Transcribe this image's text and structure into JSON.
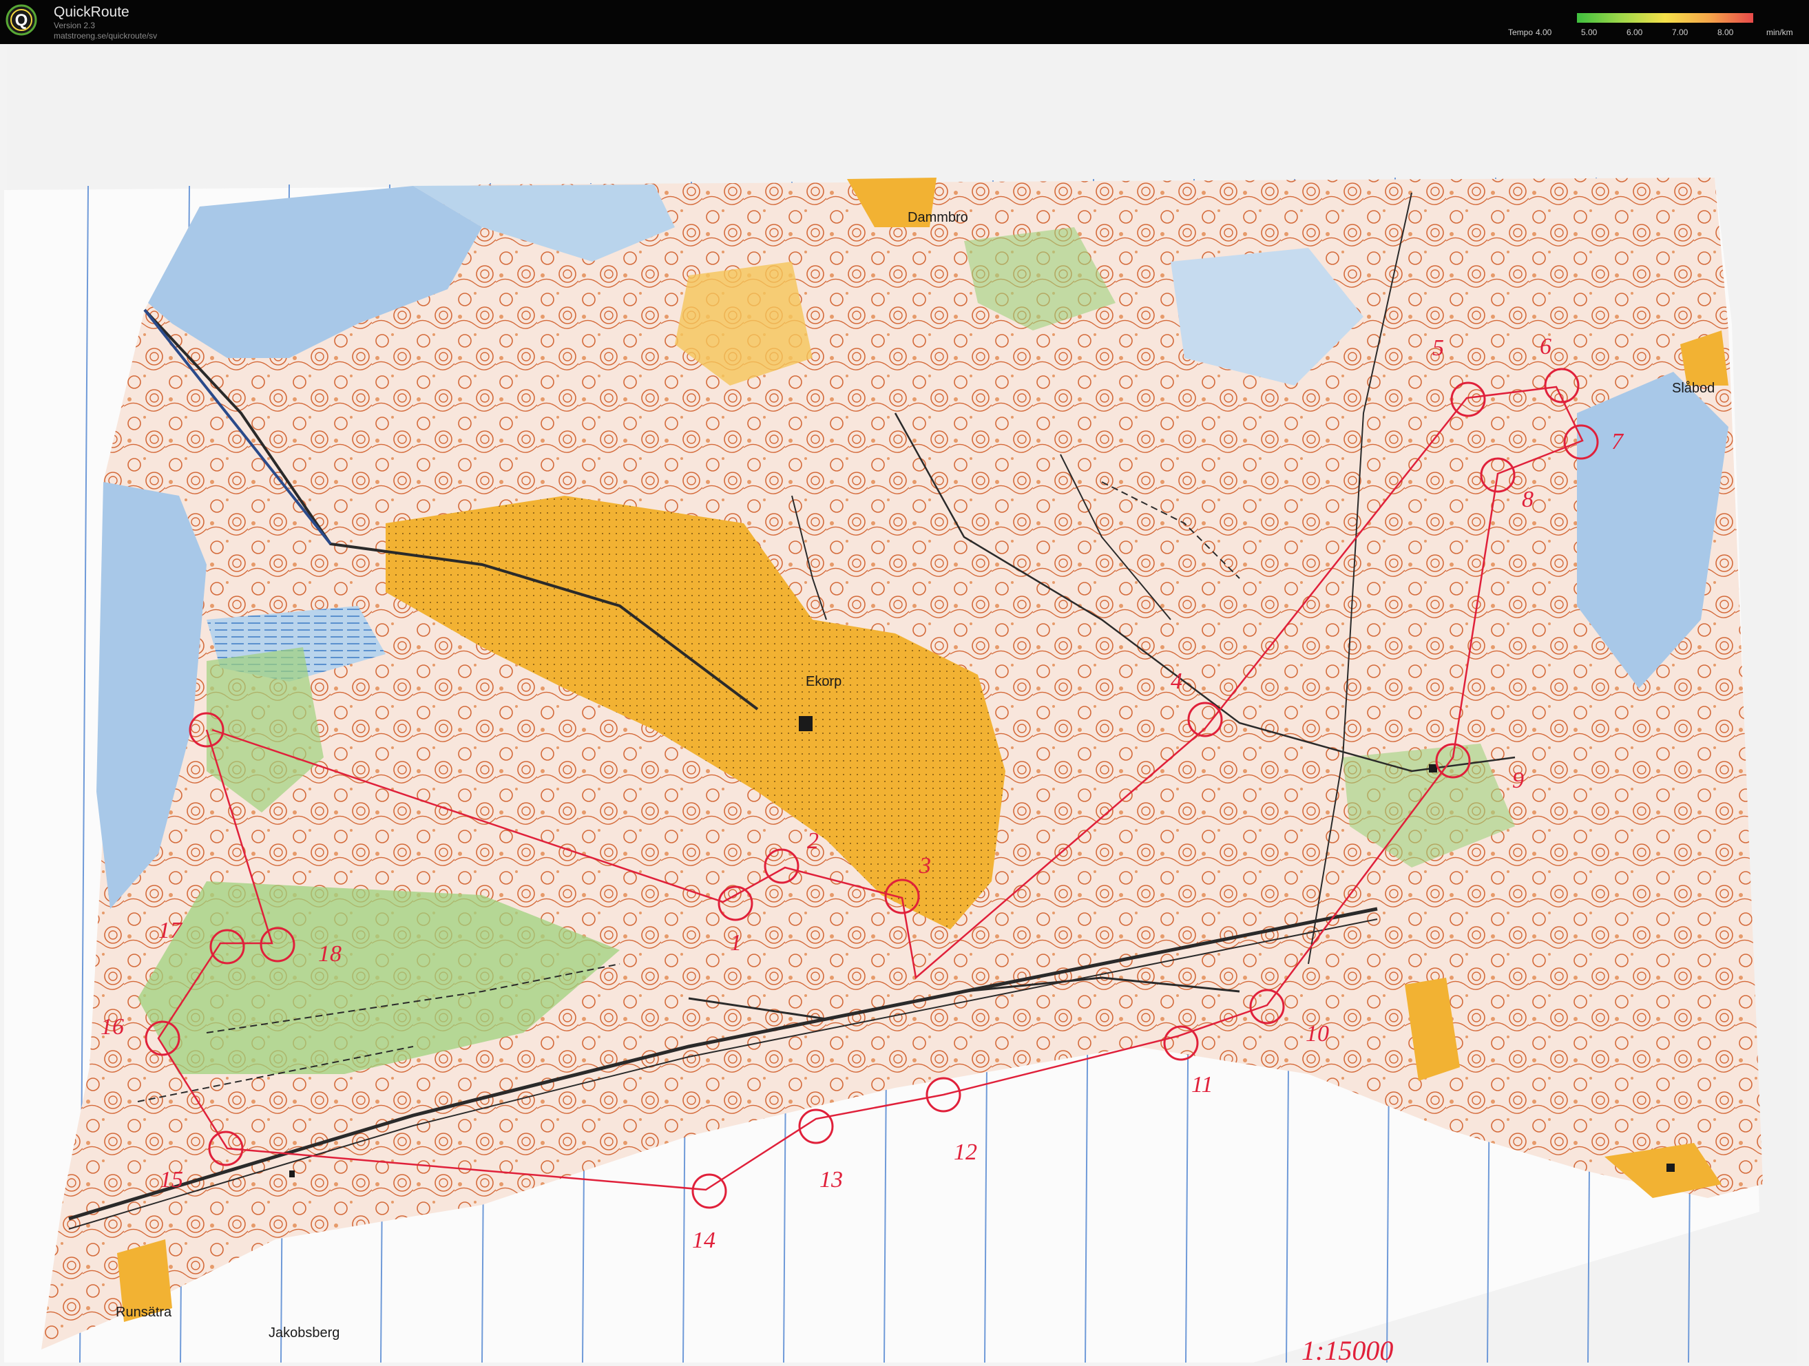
{
  "app": {
    "name": "QuickRoute",
    "version": "Version 2.3",
    "url": "matstroeng.se/quickroute/sv",
    "logo_letter": "Q"
  },
  "legend": {
    "label": "Tempo",
    "ticks": [
      "4.00",
      "5.00",
      "6.00",
      "7.00",
      "8.00"
    ],
    "unit": "min/km",
    "colors": [
      "#3fbf3f",
      "#9fd84a",
      "#f5e04a",
      "#f5a64a",
      "#e84a4a"
    ]
  },
  "map": {
    "place_names": [
      "Dammbro",
      "Ekorp",
      "Slåbod",
      "Runsätra",
      "Jakobsberg"
    ],
    "controls": [
      "1",
      "2",
      "3",
      "4",
      "5",
      "6",
      "7",
      "8",
      "9",
      "10",
      "11",
      "12",
      "13",
      "14",
      "15",
      "16",
      "17",
      "18"
    ],
    "scale_note": "1:15000",
    "colors": {
      "paper": "#fbf9f6",
      "water": "#a8c8e8",
      "open_land": "#f2b233",
      "contour": "#d46a3a",
      "green": "#9fd27d",
      "course": "#e0203a"
    }
  }
}
